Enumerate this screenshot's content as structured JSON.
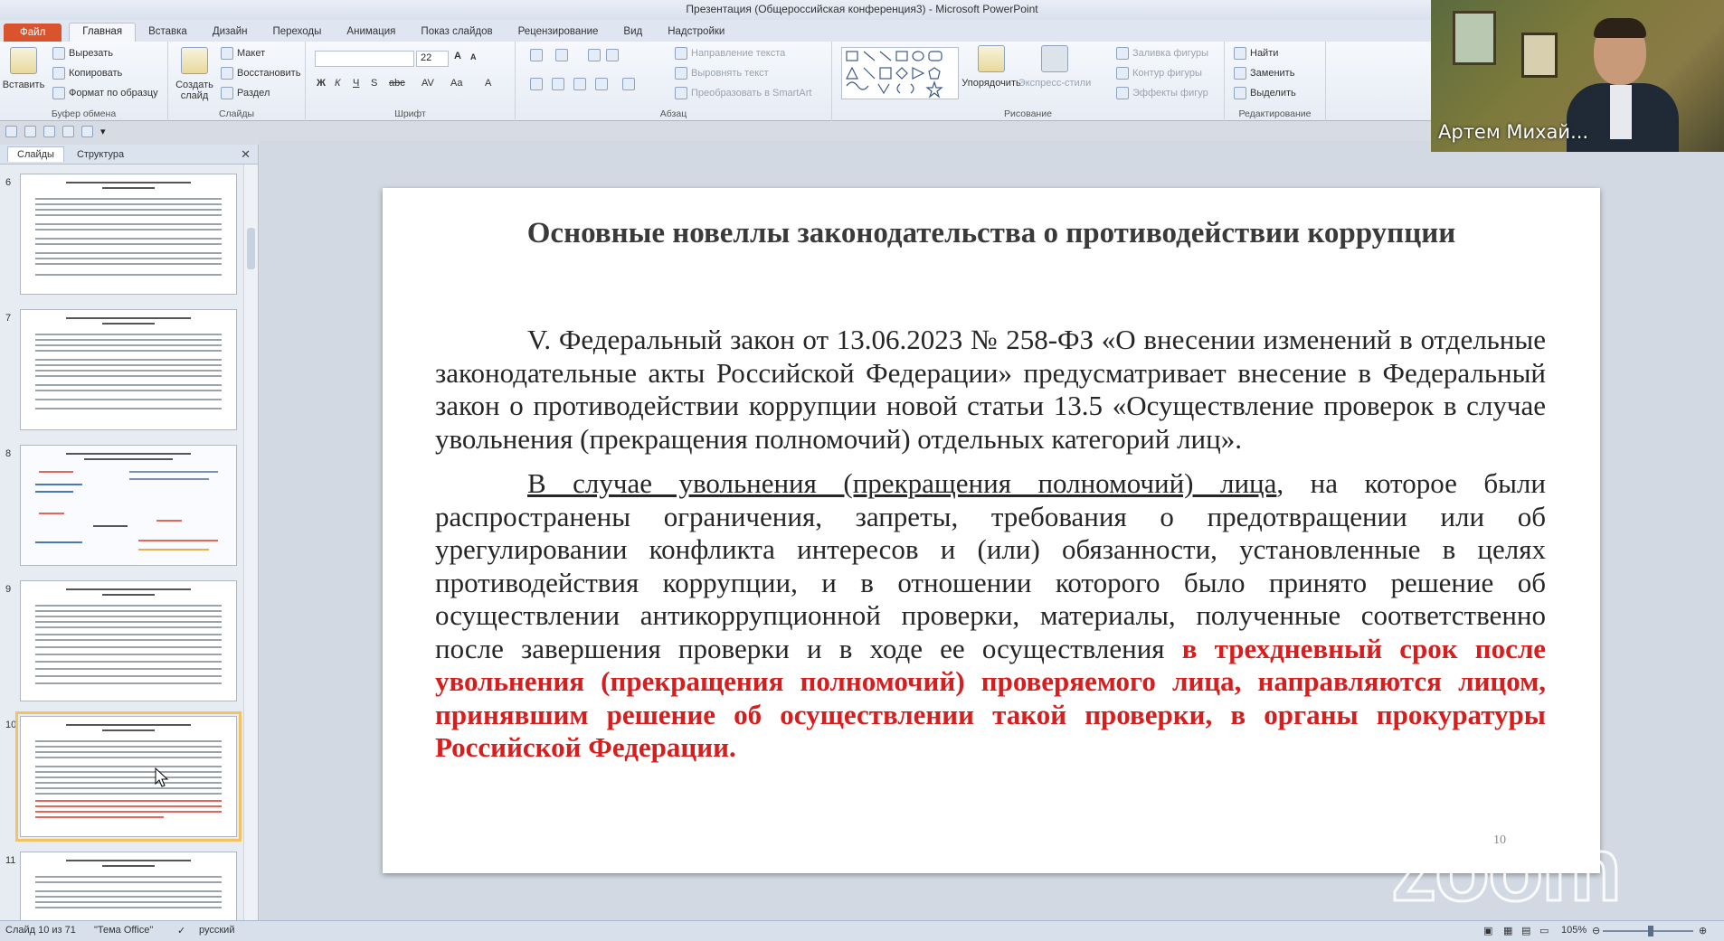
{
  "window": {
    "title": "Презентация (Общероссийская конференция3) - Microsoft PowerPoint"
  },
  "ribbon_tabs": [
    "Файл",
    "Главная",
    "Вставка",
    "Дизайн",
    "Переходы",
    "Анимация",
    "Показ слайдов",
    "Рецензирование",
    "Вид",
    "Надстройки"
  ],
  "ribbon": {
    "clipboard": {
      "paste": "Вставить",
      "cut": "Вырезать",
      "copy": "Копировать",
      "format_painter": "Формат по образцу",
      "label": "Буфер обмена"
    },
    "slides": {
      "new_slide": "Создать слайд",
      "layout": "Макет",
      "reset": "Восстановить",
      "section": "Раздел",
      "label": "Слайды"
    },
    "font": {
      "size": "22",
      "label": "Шрифт"
    },
    "paragraph": {
      "text_direction": "Направление текста",
      "align_text": "Выровнять текст",
      "smartart": "Преобразовать в SmartArt",
      "label": "Абзац"
    },
    "drawing": {
      "arrange": "Упорядочить",
      "quick_styles": "Экспресс-стили",
      "shape_fill": "Заливка фигуры",
      "shape_outline": "Контур фигуры",
      "shape_effects": "Эффекты фигур",
      "label": "Рисование"
    },
    "editing": {
      "find": "Найти",
      "replace": "Заменить",
      "select": "Выделить",
      "label": "Редактирование"
    }
  },
  "left_pane": {
    "tabs": [
      "Слайды",
      "Структура"
    ],
    "thumbnail_numbers": [
      "6",
      "7",
      "8",
      "9",
      "10",
      "11"
    ],
    "selected": "10"
  },
  "slide": {
    "title": "Основные новеллы законодательства о противодействии коррупции",
    "para1": "V. Федеральный закон от 13.06.2023 № 258-ФЗ «О внесении изменений в отдельные законодательные акты Российской Федерации» предусматривает внесение в Федеральный закон о противодействии коррупции новой статьи 13.5 «Осуществление проверок в случае увольнения (прекращения полномочий) отдельных категорий лиц».",
    "para2_underlined": "В случае увольнения (прекращения полномочий) лица",
    "para2_normal": ", на которое были распространены ограничения, запреты, требования о предотвращении или об урегулировании конфликта интересов и (или) обязанности, установленные в целях противодействия коррупции, и в отношении которого было принято решение об осуществлении антикоррупционной проверки, материалы, полученные соответственно после завершения проверки и в ходе ее осуществления ",
    "para2_red": "в трехдневный срок после увольнения (прекращения полномочий) проверяемого лица, направляются лицом, принявшим решение об осуществлении такой проверки, в органы прокуратуры Российской Федерации.",
    "number": "10"
  },
  "webcam": {
    "name": "Артем Михай..."
  },
  "watermark": "zoom",
  "status_bar": {
    "slide_info": "Слайд 10 из 71",
    "theme": "\"Тема Office\"",
    "language": "русский",
    "zoom": "105%"
  }
}
